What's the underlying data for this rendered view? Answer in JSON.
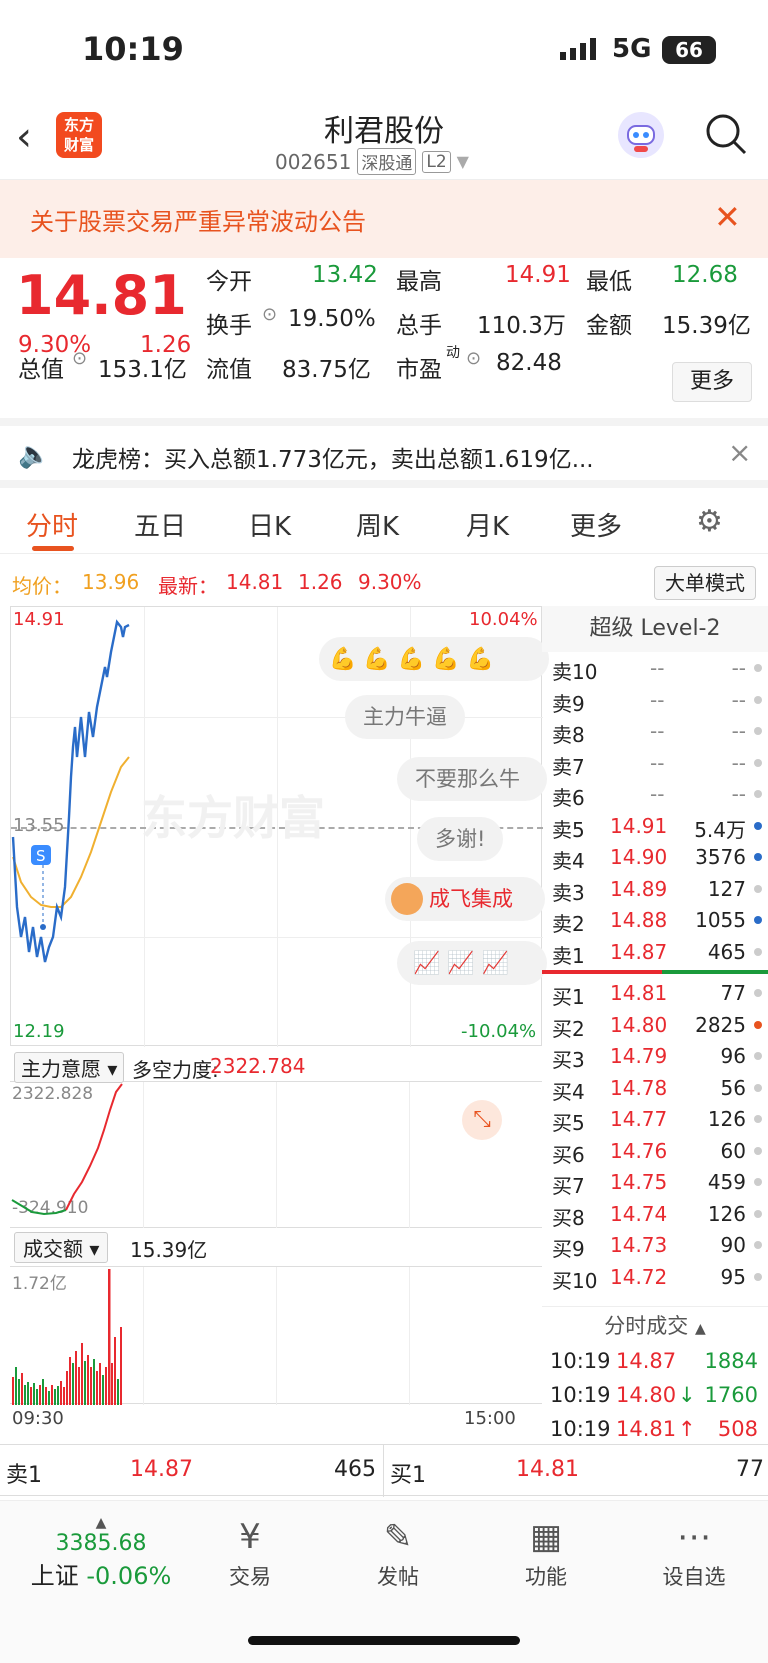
{
  "status": {
    "time": "10:19",
    "network": "5G",
    "battery": "66"
  },
  "header": {
    "logo_text": "东方财富",
    "title": "利君股份",
    "code": "002651",
    "tag1": "深股通",
    "tag2": "L2"
  },
  "notice": {
    "text": "关于股票交易严重异常波动公告"
  },
  "quote": {
    "price": "14.81",
    "pct": "9.30%",
    "change": "1.26",
    "open_label": "今开",
    "open": "13.42",
    "high_label": "最高",
    "high": "14.91",
    "low_label": "最低",
    "low": "12.68",
    "turnover_label": "换手",
    "turnover": "19.50%",
    "volume_label": "总手",
    "volume": "110.3万",
    "amount_label": "金额",
    "amount": "15.39亿",
    "mktcap_label": "总值",
    "mktcap": "153.1亿",
    "float_label": "流值",
    "float": "83.75亿",
    "pe_label": "市盈",
    "pe_sup": "动",
    "pe": "82.48",
    "more": "更多"
  },
  "lhb": {
    "text": "龙虎榜：买入总额1.773亿元，卖出总额1.619亿..."
  },
  "tabs": [
    "分时",
    "五日",
    "日K",
    "周K",
    "月K",
    "更多"
  ],
  "avgbar": {
    "avg_label": "均价：",
    "avg": "13.96",
    "latest_label": "最新：",
    "latest": "14.81",
    "chg": "1.26",
    "pct": "9.30%",
    "big_order_btn": "大单模式"
  },
  "chart": {
    "y_high": "14.91",
    "y_low": "12.19",
    "y_mid": "13.55",
    "pct_high": "10.04%",
    "pct_low": "-10.04%",
    "watermark": "东方财富",
    "bubbles": [
      "主力牛逼",
      "不要那么牛",
      "多谢!",
      "成飞集成"
    ],
    "x_start": "09:30",
    "x_end": "15:00"
  },
  "indicator": {
    "label": "主力意愿",
    "force_label": "多空力度:",
    "force": "2322.784",
    "top": "2322.828",
    "bottom": "-324.910"
  },
  "volume": {
    "label": "成交额",
    "total": "15.39亿",
    "top": "1.72亿"
  },
  "book": {
    "title": "超级 Level-2",
    "asks": [
      {
        "label": "卖10",
        "price": "--",
        "vol": "--"
      },
      {
        "label": "卖9",
        "price": "--",
        "vol": "--"
      },
      {
        "label": "卖8",
        "price": "--",
        "vol": "--"
      },
      {
        "label": "卖7",
        "price": "--",
        "vol": "--"
      },
      {
        "label": "卖6",
        "price": "--",
        "vol": "--"
      },
      {
        "label": "卖5",
        "price": "14.91",
        "vol": "5.4万"
      },
      {
        "label": "卖4",
        "price": "14.90",
        "vol": "3576"
      },
      {
        "label": "卖3",
        "price": "14.89",
        "vol": "127"
      },
      {
        "label": "卖2",
        "price": "14.88",
        "vol": "1055"
      },
      {
        "label": "卖1",
        "price": "14.87",
        "vol": "465"
      }
    ],
    "bids": [
      {
        "label": "买1",
        "price": "14.81",
        "vol": "77"
      },
      {
        "label": "买2",
        "price": "14.80",
        "vol": "2825"
      },
      {
        "label": "买3",
        "price": "14.79",
        "vol": "96"
      },
      {
        "label": "买4",
        "price": "14.78",
        "vol": "56"
      },
      {
        "label": "买5",
        "price": "14.77",
        "vol": "126"
      },
      {
        "label": "买6",
        "price": "14.76",
        "vol": "60"
      },
      {
        "label": "买7",
        "price": "14.75",
        "vol": "459"
      },
      {
        "label": "买8",
        "price": "14.74",
        "vol": "126"
      },
      {
        "label": "买9",
        "price": "14.73",
        "vol": "90"
      },
      {
        "label": "买10",
        "price": "14.72",
        "vol": "95"
      }
    ]
  },
  "ticks": {
    "title": "分时成交",
    "rows": [
      {
        "time": "10:19",
        "price": "14.87",
        "vol": "1884",
        "arrow": ""
      },
      {
        "time": "10:19",
        "price": "14.80",
        "vol": "1760",
        "arrow": "↓"
      },
      {
        "time": "10:19",
        "price": "14.81",
        "vol": "508",
        "arrow": "↑"
      }
    ]
  },
  "best": {
    "sell_label": "卖1",
    "sell_price": "14.87",
    "sell_vol": "465",
    "buy_label": "买1",
    "buy_price": "14.81",
    "buy_vol": "77"
  },
  "nav": {
    "index_value": "3385.68",
    "index_name": "上证",
    "index_pct": "-0.06%",
    "items": [
      {
        "label": "交易",
        "icon": "yen-cycle-icon"
      },
      {
        "label": "发帖",
        "icon": "edit-icon"
      },
      {
        "label": "功能",
        "icon": "grid-icon"
      },
      {
        "label": "设自选",
        "icon": "more-dots-icon"
      }
    ]
  }
}
